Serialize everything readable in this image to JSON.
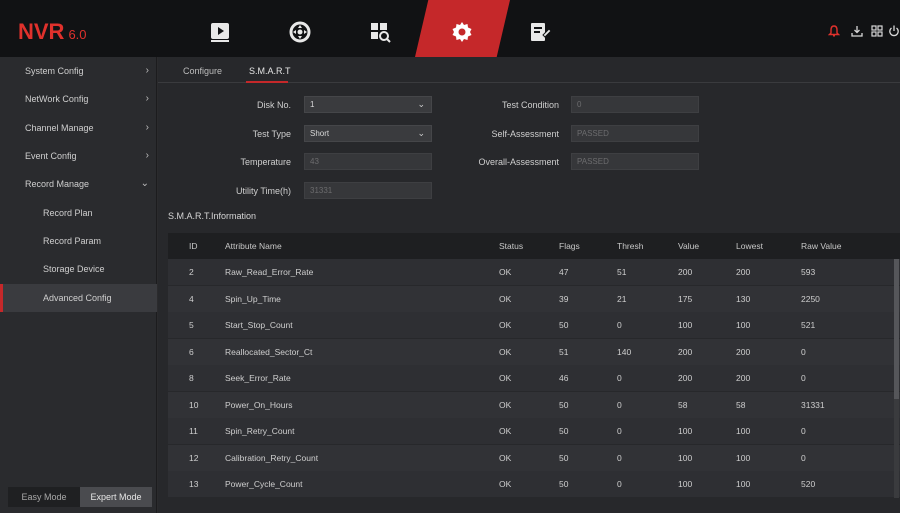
{
  "app": {
    "logo": "NVR",
    "version": "6.0"
  },
  "topnav": {
    "icons": [
      "playback-icon",
      "ptz-icon",
      "search-icon",
      "settings-icon",
      "maintenance-icon"
    ],
    "active": "settings-icon",
    "right_icons": [
      "alarm-icon",
      "download-icon",
      "layout-icon",
      "power-icon"
    ]
  },
  "sidebar": {
    "items": [
      {
        "label": "System Config",
        "chevron": "›"
      },
      {
        "label": "NetWork Config",
        "chevron": "›"
      },
      {
        "label": "Channel Manage",
        "chevron": "›"
      },
      {
        "label": "Event Config",
        "chevron": "›"
      },
      {
        "label": "Record Manage",
        "chevron": "⌄"
      }
    ],
    "subitems": [
      {
        "label": "Record Plan"
      },
      {
        "label": "Record Param"
      },
      {
        "label": "Storage Device"
      },
      {
        "label": "Advanced Config",
        "active": true
      }
    ],
    "modes": {
      "easy": "Easy Mode",
      "expert": "Expert Mode",
      "selected": "Expert Mode"
    }
  },
  "tabs": {
    "configure": "Configure",
    "smart": "S.M.A.R.T",
    "active": "S.M.A.R.T"
  },
  "form": {
    "disk_no": {
      "label": "Disk No.",
      "value": "1"
    },
    "test_type": {
      "label": "Test Type",
      "value": "Short"
    },
    "temperature": {
      "label": "Temperature",
      "value": "43"
    },
    "utility_time": {
      "label": "Utility Time(h)",
      "value": "31331"
    },
    "test_condition": {
      "label": "Test Condition",
      "value": "0"
    },
    "self_assessment": {
      "label": "Self-Assessment",
      "value": "PASSED"
    },
    "overall_assessment": {
      "label": "Overall-Assessment",
      "value": "PASSED"
    }
  },
  "smart_info": {
    "title": "S.M.A.R.T.Information",
    "columns": [
      "ID",
      "Attribute Name",
      "Status",
      "Flags",
      "Thresh",
      "Value",
      "Lowest",
      "Raw Value"
    ],
    "rows": [
      [
        "2",
        "Raw_Read_Error_Rate",
        "OK",
        "47",
        "51",
        "200",
        "200",
        "593"
      ],
      [
        "4",
        "Spin_Up_Time",
        "OK",
        "39",
        "21",
        "175",
        "130",
        "2250"
      ],
      [
        "5",
        "Start_Stop_Count",
        "OK",
        "50",
        "0",
        "100",
        "100",
        "521"
      ],
      [
        "6",
        "Reallocated_Sector_Ct",
        "OK",
        "51",
        "140",
        "200",
        "200",
        "0"
      ],
      [
        "8",
        "Seek_Error_Rate",
        "OK",
        "46",
        "0",
        "200",
        "200",
        "0"
      ],
      [
        "10",
        "Power_On_Hours",
        "OK",
        "50",
        "0",
        "58",
        "58",
        "31331"
      ],
      [
        "11",
        "Spin_Retry_Count",
        "OK",
        "50",
        "0",
        "100",
        "100",
        "0"
      ],
      [
        "12",
        "Calibration_Retry_Count",
        "OK",
        "50",
        "0",
        "100",
        "100",
        "0"
      ],
      [
        "13",
        "Power_Cycle_Count",
        "OK",
        "50",
        "0",
        "100",
        "100",
        "520"
      ]
    ]
  },
  "colors": {
    "accent": "#c5282a",
    "logo": "#e0312c",
    "background": "#27282b",
    "topbar": "#111214"
  }
}
